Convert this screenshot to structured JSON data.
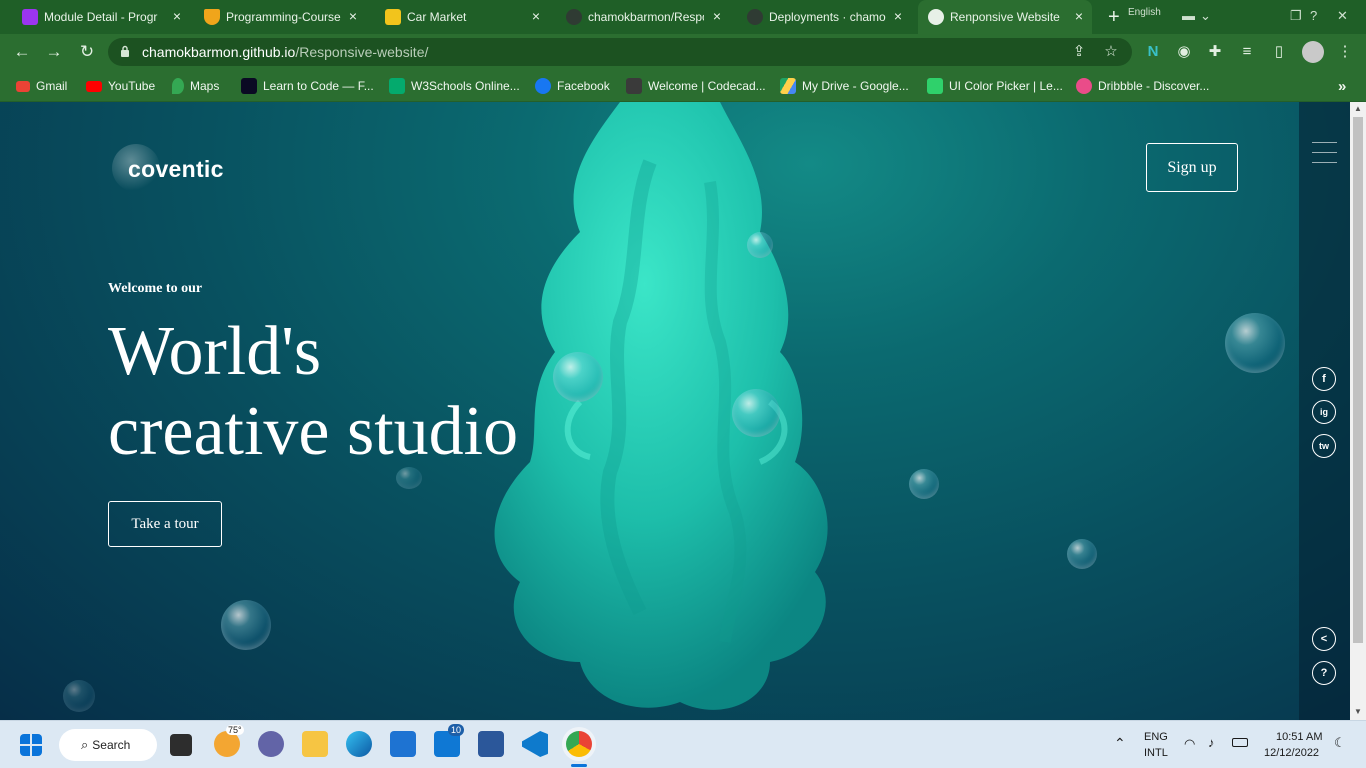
{
  "browser": {
    "tabs": [
      {
        "label": "Module Detail - Progr",
        "favicon_color": "#9b35f0",
        "active": false
      },
      {
        "label": "Programming-Course",
        "favicon_color": "#f0a51b",
        "active": false
      },
      {
        "label": "Car Market",
        "favicon_color": "#f2c41c",
        "active": false
      },
      {
        "label": "chamokbarmon/Respo",
        "favicon_color": "#2f3b33",
        "active": false
      },
      {
        "label": "Deployments · chamo",
        "favicon_color": "#2f3b33",
        "active": false
      },
      {
        "label": "Renponsive Website",
        "favicon_color": "#e7f0e7",
        "active": true
      }
    ],
    "new_tab_symbol": "+",
    "language_indicator": "English",
    "url_host": "chamokbarmon.github.io",
    "url_path": "/Responsive-website/",
    "bookmarks": [
      {
        "label": "Gmail",
        "color": "#ea4335"
      },
      {
        "label": "YouTube",
        "color": "#ff0000"
      },
      {
        "label": "Maps",
        "color": "#34a853"
      },
      {
        "label": "Learn to Code — F...",
        "color": "#0a0a23"
      },
      {
        "label": "W3Schools Online...",
        "color": "#04aa6d"
      },
      {
        "label": "Facebook",
        "color": "#1877f2"
      },
      {
        "label": "Welcome | Codecad...",
        "color": "#3a3a3a"
      },
      {
        "label": "My Drive - Google...",
        "color": "#fbbc04"
      },
      {
        "label": "UI Color Picker | Le...",
        "color": "#2fd16b"
      },
      {
        "label": "Dribbble - Discover...",
        "color": "#ea4c89"
      }
    ],
    "more_bookmarks": "»"
  },
  "site": {
    "logo": "coventic",
    "signup_label": "Sign up",
    "welcome": "Welcome to our",
    "headline_line1": "World's",
    "headline_line2": "creative studio",
    "tour_label": "Take a tour",
    "social": [
      "f",
      "ig",
      "tw"
    ],
    "share_symbol": "<",
    "help_symbol": "?"
  },
  "taskbar": {
    "search_label": "Search",
    "weather": "75°",
    "mail_badge": "10",
    "lang_line1": "ENG",
    "lang_line2": "INTL",
    "time": "10:51 AM",
    "date": "12/12/2022"
  },
  "colors": {
    "tab_bar": "#1f5f27",
    "toolbar": "#2b6e30",
    "hero_teal": "#138a86",
    "smoke": "#2ad1b6"
  }
}
